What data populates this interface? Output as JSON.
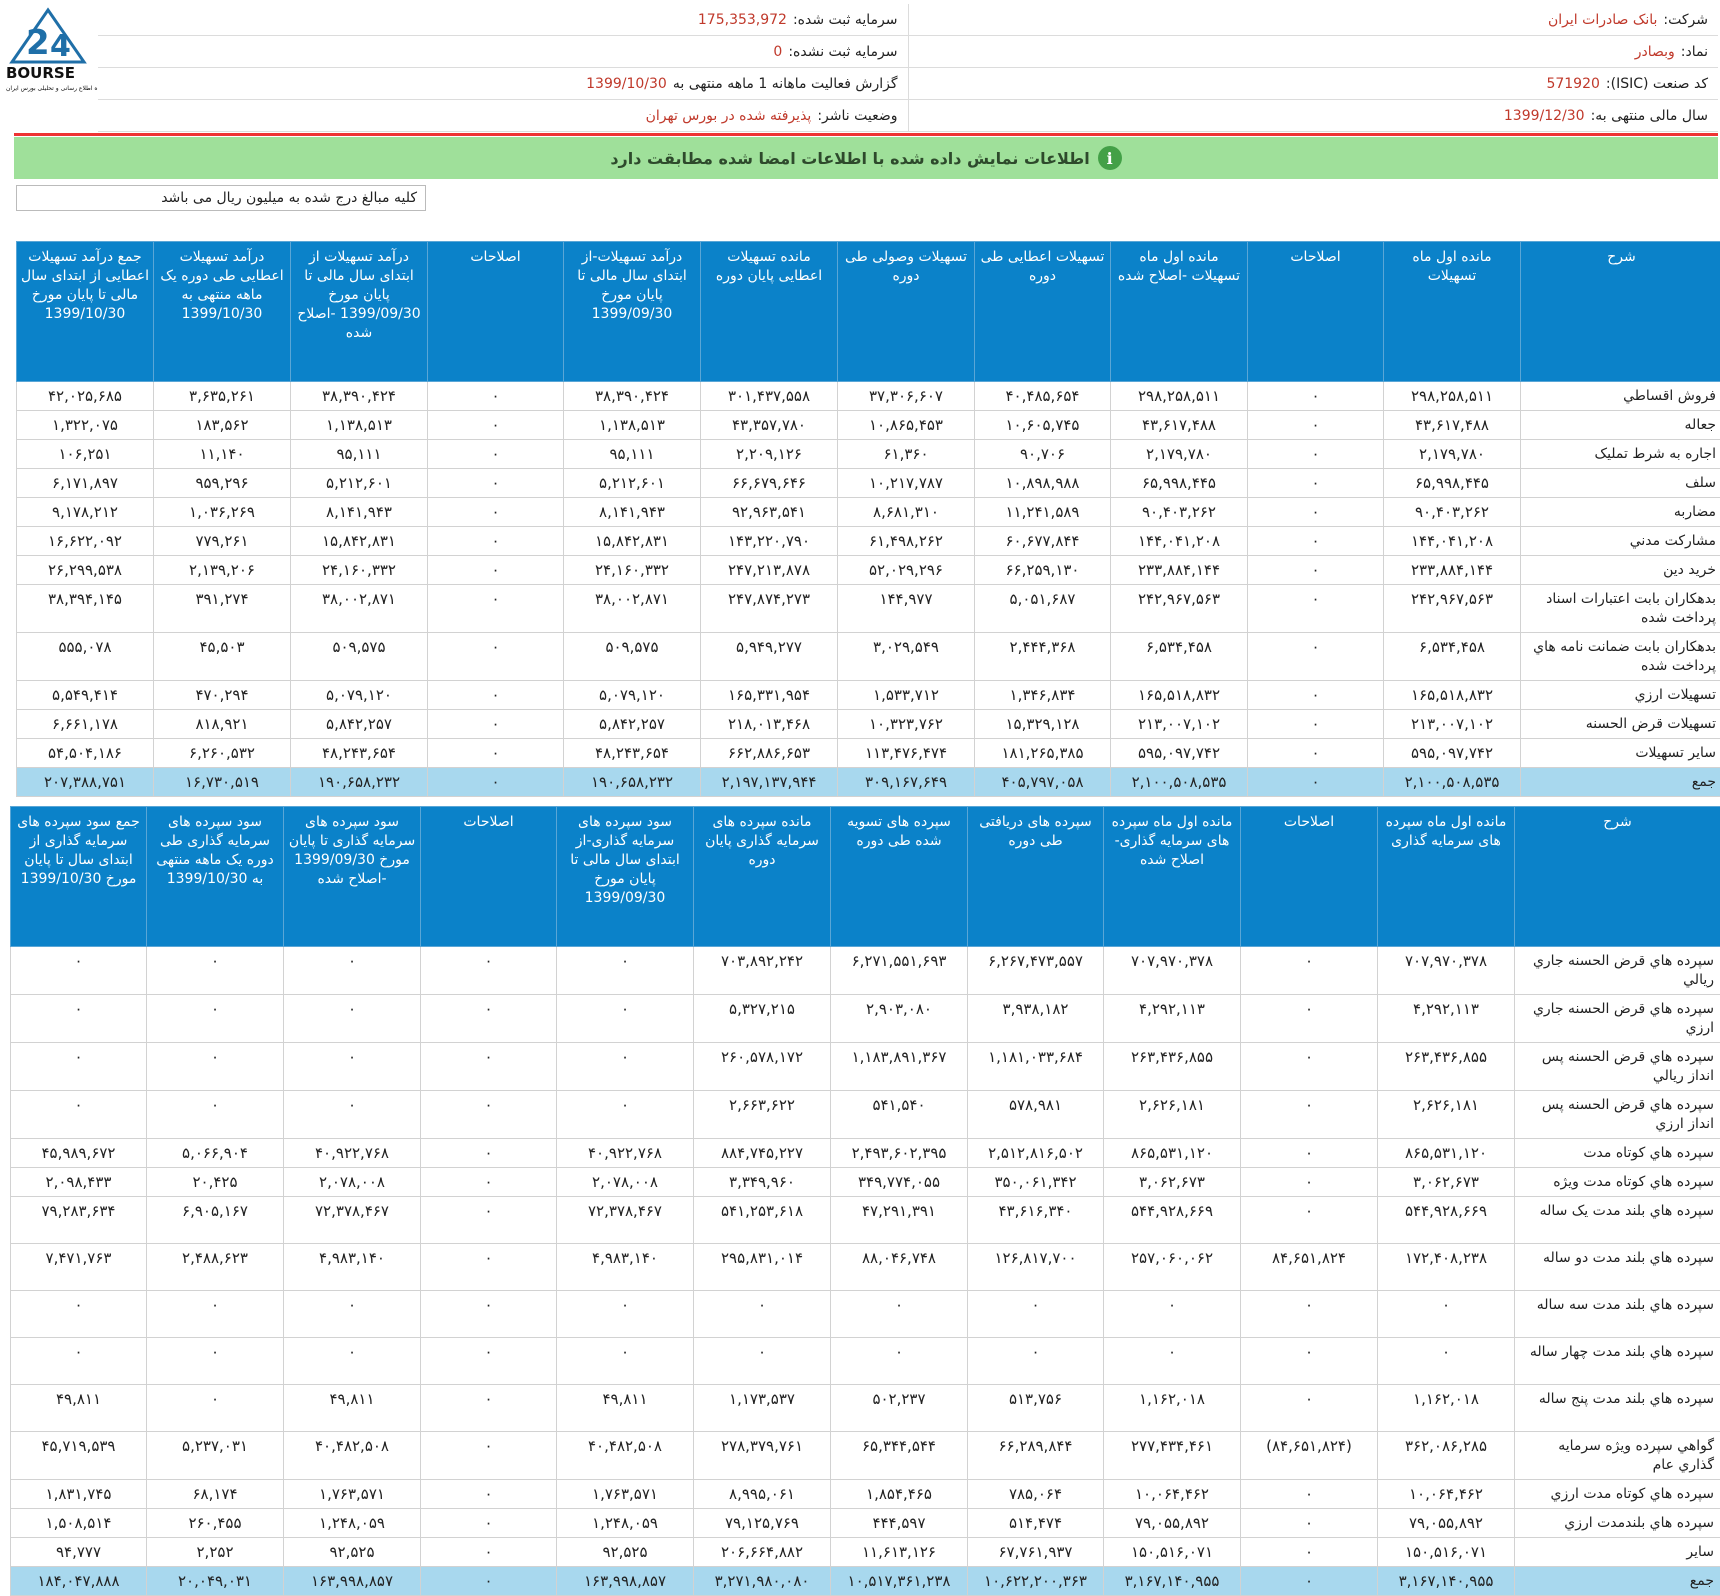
{
  "logo": {
    "name": "BOURSE",
    "tagline": "پایگاه اطلاع رسانی و تحلیلی بورس ایران"
  },
  "header": {
    "rows": [
      [
        {
          "k": "شرکت:",
          "v": "بانک صادرات ایران"
        },
        {
          "k": "سرمایه ثبت شده:",
          "v": "175,353,972"
        }
      ],
      [
        {
          "k": "نماد:",
          "v": "وبصادر"
        },
        {
          "k": "سرمایه ثبت نشده:",
          "v": "0"
        }
      ],
      [
        {
          "k": "کد صنعت (ISIC):",
          "v": "571920"
        },
        {
          "k": "گزارش فعالیت ماهانه 1 ماهه منتهی به",
          "v": "1399/10/30"
        }
      ],
      [
        {
          "k": "سال مالی منتهی به:",
          "v": "1399/12/30"
        },
        {
          "k": "وضعیت ناشر:",
          "v": "پذیرفته شده در بورس تهران"
        }
      ]
    ]
  },
  "banner": {
    "icon": "info-icon",
    "text": "اطلاعات نمایش داده شده با اطلاعات امضا شده مطابقت دارد"
  },
  "unit_note": "کلیه مبالغ درج شده به میلیون ریال می باشد",
  "colors": {
    "header_blue": "#0b82c9",
    "total_row": "#a8d8ee",
    "banner_green": "#9fe09a",
    "value_red": "#c0392b"
  },
  "table1": {
    "headers": [
      "شرح",
      "مانده اول ماه تسهیلات",
      "اصلاحات",
      "مانده اول ماه تسهیلات -اصلاح شده",
      "تسهیلات اعطایی طی دوره",
      "تسهیلات وصولی طی دوره",
      "مانده تسهیلات اعطایی پایان دوره",
      "درآمد تسهیلات-از ابتدای سال مالی تا پایان مورخ 1399/09/30",
      "اصلاحات",
      "درآمد تسهیلات از ابتدای سال مالی تا پایان مورخ 1399/09/30 -اصلاح شده",
      "درآمد تسهیلات اعطایی طی دوره یک ماهه منتهی به 1399/10/30",
      "جمع درآمد تسهیلات اعطایی از ابتدای سال مالی تا پایان مورخ 1399/10/30"
    ],
    "rows": [
      [
        "فروش اقساطي",
        "۲۹۸,۲۵۸,۵۱۱",
        "۰",
        "۲۹۸,۲۵۸,۵۱۱",
        "۴۰,۴۸۵,۶۵۴",
        "۳۷,۳۰۶,۶۰۷",
        "۳۰۱,۴۳۷,۵۵۸",
        "۳۸,۳۹۰,۴۲۴",
        "۰",
        "۳۸,۳۹۰,۴۲۴",
        "۳,۶۳۵,۲۶۱",
        "۴۲,۰۲۵,۶۸۵"
      ],
      [
        "جعاله",
        "۴۳,۶۱۷,۴۸۸",
        "۰",
        "۴۳,۶۱۷,۴۸۸",
        "۱۰,۶۰۵,۷۴۵",
        "۱۰,۸۶۵,۴۵۳",
        "۴۳,۳۵۷,۷۸۰",
        "۱,۱۳۸,۵۱۳",
        "۰",
        "۱,۱۳۸,۵۱۳",
        "۱۸۳,۵۶۲",
        "۱,۳۲۲,۰۷۵"
      ],
      [
        "اجاره به شرط تمليک",
        "۲,۱۷۹,۷۸۰",
        "۰",
        "۲,۱۷۹,۷۸۰",
        "۹۰,۷۰۶",
        "۶۱,۳۶۰",
        "۲,۲۰۹,۱۲۶",
        "۹۵,۱۱۱",
        "۰",
        "۹۵,۱۱۱",
        "۱۱,۱۴۰",
        "۱۰۶,۲۵۱"
      ],
      [
        "سلف",
        "۶۵,۹۹۸,۴۴۵",
        "۰",
        "۶۵,۹۹۸,۴۴۵",
        "۱۰,۸۹۸,۹۸۸",
        "۱۰,۲۱۷,۷۸۷",
        "۶۶,۶۷۹,۶۴۶",
        "۵,۲۱۲,۶۰۱",
        "۰",
        "۵,۲۱۲,۶۰۱",
        "۹۵۹,۲۹۶",
        "۶,۱۷۱,۸۹۷"
      ],
      [
        "مضاربه",
        "۹۰,۴۰۳,۲۶۲",
        "۰",
        "۹۰,۴۰۳,۲۶۲",
        "۱۱,۲۴۱,۵۸۹",
        "۸,۶۸۱,۳۱۰",
        "۹۲,۹۶۳,۵۴۱",
        "۸,۱۴۱,۹۴۳",
        "۰",
        "۸,۱۴۱,۹۴۳",
        "۱,۰۳۶,۲۶۹",
        "۹,۱۷۸,۲۱۲"
      ],
      [
        "مشارکت مدني",
        "۱۴۴,۰۴۱,۲۰۸",
        "۰",
        "۱۴۴,۰۴۱,۲۰۸",
        "۶۰,۶۷۷,۸۴۴",
        "۶۱,۴۹۸,۲۶۲",
        "۱۴۳,۲۲۰,۷۹۰",
        "۱۵,۸۴۲,۸۳۱",
        "۰",
        "۱۵,۸۴۲,۸۳۱",
        "۷۷۹,۲۶۱",
        "۱۶,۶۲۲,۰۹۲"
      ],
      [
        "خريد دين",
        "۲۳۳,۸۸۴,۱۴۴",
        "۰",
        "۲۳۳,۸۸۴,۱۴۴",
        "۶۶,۲۵۹,۱۳۰",
        "۵۲,۰۲۹,۲۹۶",
        "۲۴۷,۲۱۳,۸۷۸",
        "۲۴,۱۶۰,۳۳۲",
        "۰",
        "۲۴,۱۶۰,۳۳۲",
        "۲,۱۳۹,۲۰۶",
        "۲۶,۲۹۹,۵۳۸"
      ],
      [
        "بدهکاران بابت اعتبارات اسناد پرداخت شده",
        "۲۴۲,۹۶۷,۵۶۳",
        "۰",
        "۲۴۲,۹۶۷,۵۶۳",
        "۵,۰۵۱,۶۸۷",
        "۱۴۴,۹۷۷",
        "۲۴۷,۸۷۴,۲۷۳",
        "۳۸,۰۰۲,۸۷۱",
        "۰",
        "۳۸,۰۰۲,۸۷۱",
        "۳۹۱,۲۷۴",
        "۳۸,۳۹۴,۱۴۵"
      ],
      [
        "بدهکاران بابت ضمانت نامه هاي پرداخت شده",
        "۶,۵۳۴,۴۵۸",
        "۰",
        "۶,۵۳۴,۴۵۸",
        "۲,۴۴۴,۳۶۸",
        "۳,۰۲۹,۵۴۹",
        "۵,۹۴۹,۲۷۷",
        "۵۰۹,۵۷۵",
        "۰",
        "۵۰۹,۵۷۵",
        "۴۵,۵۰۳",
        "۵۵۵,۰۷۸"
      ],
      [
        "تسهيلات ارزي",
        "۱۶۵,۵۱۸,۸۳۲",
        "۰",
        "۱۶۵,۵۱۸,۸۳۲",
        "۱,۳۴۶,۸۳۴",
        "۱,۵۳۳,۷۱۲",
        "۱۶۵,۳۳۱,۹۵۴",
        "۵,۰۷۹,۱۲۰",
        "۰",
        "۵,۰۷۹,۱۲۰",
        "۴۷۰,۲۹۴",
        "۵,۵۴۹,۴۱۴"
      ],
      [
        "تسهيلات قرض الحسنه",
        "۲۱۳,۰۰۷,۱۰۲",
        "۰",
        "۲۱۳,۰۰۷,۱۰۲",
        "۱۵,۳۲۹,۱۲۸",
        "۱۰,۳۲۳,۷۶۲",
        "۲۱۸,۰۱۳,۴۶۸",
        "۵,۸۴۲,۲۵۷",
        "۰",
        "۵,۸۴۲,۲۵۷",
        "۸۱۸,۹۲۱",
        "۶,۶۶۱,۱۷۸"
      ],
      [
        "ساير تسهيلات",
        "۵۹۵,۰۹۷,۷۴۲",
        "۰",
        "۵۹۵,۰۹۷,۷۴۲",
        "۱۸۱,۲۶۵,۳۸۵",
        "۱۱۳,۴۷۶,۴۷۴",
        "۶۶۲,۸۸۶,۶۵۳",
        "۴۸,۲۴۳,۶۵۴",
        "۰",
        "۴۸,۲۴۳,۶۵۴",
        "۶,۲۶۰,۵۳۲",
        "۵۴,۵۰۴,۱۸۶"
      ]
    ],
    "total": [
      "جمع",
      "۲,۱۰۰,۵۰۸,۵۳۵",
      "۰",
      "۲,۱۰۰,۵۰۸,۵۳۵",
      "۴۰۵,۷۹۷,۰۵۸",
      "۳۰۹,۱۶۷,۶۴۹",
      "۲,۱۹۷,۱۳۷,۹۴۴",
      "۱۹۰,۶۵۸,۲۳۲",
      "۰",
      "۱۹۰,۶۵۸,۲۳۲",
      "۱۶,۷۳۰,۵۱۹",
      "۲۰۷,۳۸۸,۷۵۱"
    ]
  },
  "table2": {
    "headers": [
      "شرح",
      "مانده اول ماه سپرده های سرمایه گذاری",
      "اصلاحات",
      "مانده اول ماه سپرده های سرمایه گذاری-اصلاح شده",
      "سپرده های دریافتی طی دوره",
      "سپرده های تسویه شده طی دوره",
      "مانده سپرده های سرمایه گذاری پایان دوره",
      "سود سپرده های سرمایه گذاری-از ابتدای سال مالی تا پایان مورخ 1399/09/30",
      "اصلاحات",
      "سود سپرده های سرمایه گذاری تا پایان مورخ 1399/09/30 -اصلاح شده",
      "سود سپرده های سرمایه گذاری طی دوره یک ماهه منتهی به 1399/10/30",
      "جمع سود سپرده های سرمایه گذاری از ابتدای سال تا پایان مورخ 1399/10/30"
    ],
    "rows": [
      [
        "سپرده هاي قرض الحسنه جاري ريالي",
        "۷۰۷,۹۷۰,۳۷۸",
        "۰",
        "۷۰۷,۹۷۰,۳۷۸",
        "۶,۲۶۷,۴۷۳,۵۵۷",
        "۶,۲۷۱,۵۵۱,۶۹۳",
        "۷۰۳,۸۹۲,۲۴۲",
        "۰",
        "۰",
        "۰",
        "۰",
        "۰"
      ],
      [
        "سپرده هاي قرض الحسنه جاري ارزي",
        "۴,۲۹۲,۱۱۳",
        "۰",
        "۴,۲۹۲,۱۱۳",
        "۳,۹۳۸,۱۸۲",
        "۲,۹۰۳,۰۸۰",
        "۵,۳۲۷,۲۱۵",
        "۰",
        "۰",
        "۰",
        "۰",
        "۰"
      ],
      [
        "سپرده هاي قرض الحسنه پس انداز ريالي",
        "۲۶۳,۴۳۶,۸۵۵",
        "۰",
        "۲۶۳,۴۳۶,۸۵۵",
        "۱,۱۸۱,۰۳۳,۶۸۴",
        "۱,۱۸۳,۸۹۱,۳۶۷",
        "۲۶۰,۵۷۸,۱۷۲",
        "۰",
        "۰",
        "۰",
        "۰",
        "۰"
      ],
      [
        "سپرده هاي قرض الحسنه پس انداز ارزي",
        "۲,۶۲۶,۱۸۱",
        "۰",
        "۲,۶۲۶,۱۸۱",
        "۵۷۸,۹۸۱",
        "۵۴۱,۵۴۰",
        "۲,۶۶۳,۶۲۲",
        "۰",
        "۰",
        "۰",
        "۰",
        "۰"
      ],
      [
        "سپرده هاي کوتاه مدت",
        "۸۶۵,۵۳۱,۱۲۰",
        "۰",
        "۸۶۵,۵۳۱,۱۲۰",
        "۲,۵۱۲,۸۱۶,۵۰۲",
        "۲,۴۹۳,۶۰۲,۳۹۵",
        "۸۸۴,۷۴۵,۲۲۷",
        "۴۰,۹۲۲,۷۶۸",
        "۰",
        "۴۰,۹۲۲,۷۶۸",
        "۵,۰۶۶,۹۰۴",
        "۴۵,۹۸۹,۶۷۲"
      ],
      [
        "سپرده هاي کوتاه مدت ويژه",
        "۳,۰۶۲,۶۷۳",
        "۰",
        "۳,۰۶۲,۶۷۳",
        "۳۵۰,۰۶۱,۳۴۲",
        "۳۴۹,۷۷۴,۰۵۵",
        "۳,۳۴۹,۹۶۰",
        "۲,۰۷۸,۰۰۸",
        "۰",
        "۲,۰۷۸,۰۰۸",
        "۲۰,۴۲۵",
        "۲,۰۹۸,۴۳۳"
      ],
      [
        "سپرده هاي بلند مدت يک ساله",
        "۵۴۴,۹۲۸,۶۶۹",
        "۰",
        "۵۴۴,۹۲۸,۶۶۹",
        "۴۳,۶۱۶,۳۴۰",
        "۴۷,۲۹۱,۳۹۱",
        "۵۴۱,۲۵۳,۶۱۸",
        "۷۲,۳۷۸,۴۶۷",
        "۰",
        "۷۲,۳۷۸,۴۶۷",
        "۶,۹۰۵,۱۶۷",
        "۷۹,۲۸۳,۶۳۴"
      ],
      [
        "سپرده هاي بلند مدت دو ساله",
        "۱۷۲,۴۰۸,۲۳۸",
        "۸۴,۶۵۱,۸۲۴",
        "۲۵۷,۰۶۰,۰۶۲",
        "۱۲۶,۸۱۷,۷۰۰",
        "۸۸,۰۴۶,۷۴۸",
        "۲۹۵,۸۳۱,۰۱۴",
        "۴,۹۸۳,۱۴۰",
        "۰",
        "۴,۹۸۳,۱۴۰",
        "۲,۴۸۸,۶۲۳",
        "۷,۴۷۱,۷۶۳"
      ],
      [
        "سپرده هاي بلند مدت سه ساله",
        "۰",
        "۰",
        "۰",
        "۰",
        "۰",
        "۰",
        "۰",
        "۰",
        "۰",
        "۰",
        "۰"
      ],
      [
        "سپرده هاي بلند مدت چهار ساله",
        "۰",
        "۰",
        "۰",
        "۰",
        "۰",
        "۰",
        "۰",
        "۰",
        "۰",
        "۰",
        "۰"
      ],
      [
        "سپرده هاي بلند مدت پنج ساله",
        "۱,۱۶۲,۰۱۸",
        "۰",
        "۱,۱۶۲,۰۱۸",
        "۵۱۳,۷۵۶",
        "۵۰۲,۲۳۷",
        "۱,۱۷۳,۵۳۷",
        "۴۹,۸۱۱",
        "۰",
        "۴۹,۸۱۱",
        "۰",
        "۴۹,۸۱۱"
      ],
      [
        "گواهي سپرده ويژه سرمايه گذاري عام",
        "۳۶۲,۰۸۶,۲۸۵",
        "(۸۴,۶۵۱,۸۲۴)",
        "۲۷۷,۴۳۴,۴۶۱",
        "۶۶,۲۸۹,۸۴۴",
        "۶۵,۳۴۴,۵۴۴",
        "۲۷۸,۳۷۹,۷۶۱",
        "۴۰,۴۸۲,۵۰۸",
        "۰",
        "۴۰,۴۸۲,۵۰۸",
        "۵,۲۳۷,۰۳۱",
        "۴۵,۷۱۹,۵۳۹"
      ],
      [
        "سپرده هاي کوتاه مدت ارزي",
        "۱۰,۰۶۴,۴۶۲",
        "۰",
        "۱۰,۰۶۴,۴۶۲",
        "۷۸۵,۰۶۴",
        "۱,۸۵۴,۴۶۵",
        "۸,۹۹۵,۰۶۱",
        "۱,۷۶۳,۵۷۱",
        "۰",
        "۱,۷۶۳,۵۷۱",
        "۶۸,۱۷۴",
        "۱,۸۳۱,۷۴۵"
      ],
      [
        "سپرده هاي بلندمدت ارزي",
        "۷۹,۰۵۵,۸۹۲",
        "۰",
        "۷۹,۰۵۵,۸۹۲",
        "۵۱۴,۴۷۴",
        "۴۴۴,۵۹۷",
        "۷۹,۱۲۵,۷۶۹",
        "۱,۲۴۸,۰۵۹",
        "۰",
        "۱,۲۴۸,۰۵۹",
        "۲۶۰,۴۵۵",
        "۱,۵۰۸,۵۱۴"
      ],
      [
        "ساير",
        "۱۵۰,۵۱۶,۰۷۱",
        "۰",
        "۱۵۰,۵۱۶,۰۷۱",
        "۶۷,۷۶۱,۹۳۷",
        "۱۱,۶۱۳,۱۲۶",
        "۲۰۶,۶۶۴,۸۸۲",
        "۹۲,۵۲۵",
        "۰",
        "۹۲,۵۲۵",
        "۲,۲۵۲",
        "۹۴,۷۷۷"
      ]
    ],
    "total": [
      "جمع",
      "۳,۱۶۷,۱۴۰,۹۵۵",
      "۰",
      "۳,۱۶۷,۱۴۰,۹۵۵",
      "۱۰,۶۲۲,۲۰۰,۳۶۳",
      "۱۰,۵۱۷,۳۶۱,۲۳۸",
      "۳,۲۷۱,۹۸۰,۰۸۰",
      "۱۶۳,۹۹۸,۸۵۷",
      "۰",
      "۱۶۳,۹۹۸,۸۵۷",
      "۲۰,۰۴۹,۰۳۱",
      "۱۸۴,۰۴۷,۸۸۸"
    ]
  }
}
